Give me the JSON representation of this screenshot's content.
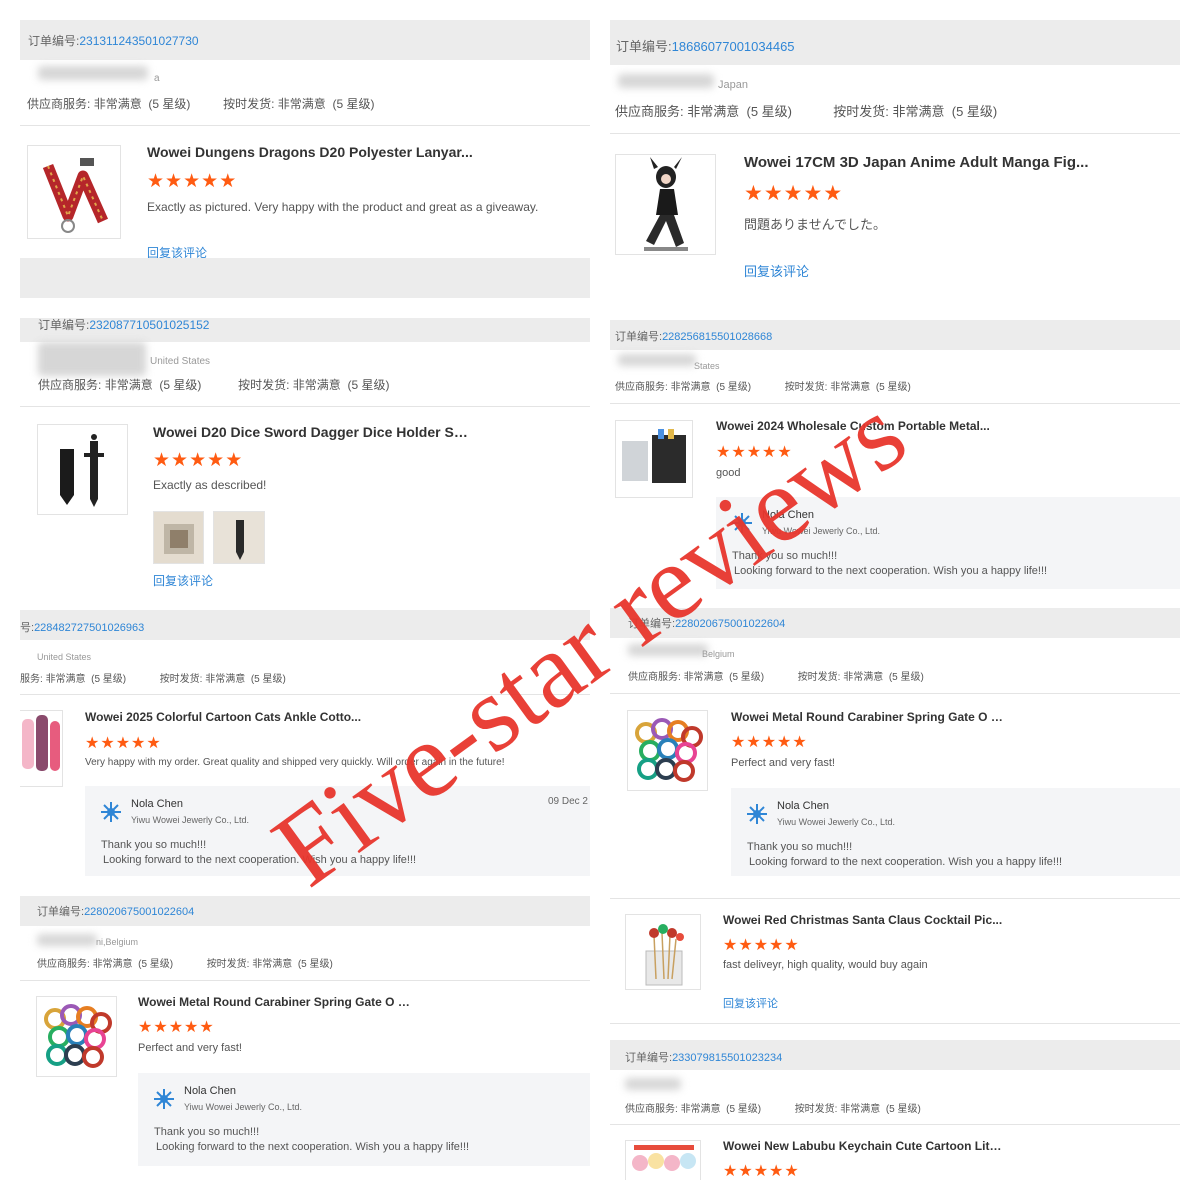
{
  "watermark": "Five-star reviews",
  "labels": {
    "order": "订单编号:",
    "supplier_service": "供应商服务:",
    "on_time": "按时发货:",
    "very_satisfied": "非常满意",
    "five_star": "(5 星级)",
    "reply": "回复该评论"
  },
  "accent": {
    "star": "#ff5b12",
    "link": "#2f86d6",
    "watermark": "#e8362d"
  },
  "seller": {
    "name": "Nola Chen",
    "company": "Yiwu Wowei Jewerly Co., Ltd.",
    "line1": "Thank you so much!!!",
    "line2": "Looking forward to the next cooperation. Wish you a happy life!!!"
  },
  "cards": [
    {
      "order_no": "231311243501027730",
      "location": "a",
      "product": "Wowei Dungens Dragons D20 Polyester Lanyar...",
      "stars": 5,
      "review": "Exactly as pictured. Very happy with the product and great as a giveaway.",
      "reply_link": "回复该评论"
    },
    {
      "order_no": "18686077001034465",
      "location": "Japan",
      "product": "Wowei 17CM 3D Japan Anime Adult Manga Fig...",
      "stars": 5,
      "review": "問題ありませんでした。",
      "reply_link": "回复该评论"
    },
    {
      "order_no": "232087710501025152",
      "location": "United States",
      "product": "Wowei D20 Dice Sword Dagger Dice Holder Set...",
      "stars": 5,
      "review": "Exactly as described!",
      "reply_link": "回复该评论"
    },
    {
      "order_no": "228256815501028668",
      "location": "States",
      "product": "Wowei 2024 Wholesale Custom Portable Metal...",
      "stars": 5,
      "review": "good"
    },
    {
      "order_no": "228482727501026963",
      "location": "United States",
      "order_label": "号:",
      "service_label": "服务:",
      "product": "Wowei 2025 Colorful Cartoon Cats Ankle Cotto...",
      "stars": 5,
      "review": "Very happy with my order.  Great quality and shipped very quickly.  Will order again in the future!",
      "reply_date": "09 Dec 2"
    },
    {
      "order_no": "228020675001022604",
      "location": "Belgium",
      "product": "Wowei Metal Round Carabiner Spring Gate O Ri...",
      "stars": 5,
      "review": "Perfect and very fast!"
    },
    {
      "order_no": "228020675001022604",
      "location": "ni,Belgium",
      "product": "Wowei Metal Round Carabiner Spring Gate O Ri...",
      "stars": 5,
      "review": "Perfect and very fast!"
    },
    {
      "product": "Wowei Red Christmas Santa Claus Cocktail Pic...",
      "stars": 5,
      "review": "fast deliveyr, high quality, would buy again",
      "reply_link": "回复该评论"
    },
    {
      "order_no": "233079815501023234",
      "product": "Wowei New Labubu Keychain Cute Cartoon Litt...",
      "stars": 5
    }
  ]
}
